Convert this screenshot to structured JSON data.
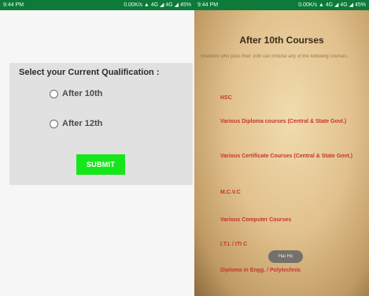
{
  "left_screen": {
    "status_bar": {
      "time": "9:44 PM",
      "right_text": "0.00K/s ▲ 4G ◢ 4G ◢ 45%"
    },
    "form": {
      "title": "Select your Current Qualification :",
      "options": [
        {
          "label": "After 10th",
          "selected": false
        },
        {
          "label": "After 12th",
          "selected": false
        }
      ],
      "submit_label": "SUBMIT"
    },
    "colors": {
      "submit_bg": "#17e61b",
      "status_bar": "#0d7a3a"
    }
  },
  "right_screen": {
    "status_bar": {
      "time": "9:44 PM",
      "right_text": "0.00K/s ▲ 4G ◢ 4G ◢ 45%"
    },
    "title": "After 10th Courses",
    "description": "Students who pass their 10th can choose any of the following courses:",
    "courses": [
      "HSC",
      "Various Diploma courses (Central & State Govt.)",
      "Various Certificate Courses (Central & State Govt.)",
      "M.C.V.C",
      "Various Computer Courses",
      "I.T.I. / ITI C",
      "Diploma in Engg. / Polytechnic"
    ],
    "toast": "Hai Ho",
    "colors": {
      "course_text": "#c8342e"
    }
  }
}
